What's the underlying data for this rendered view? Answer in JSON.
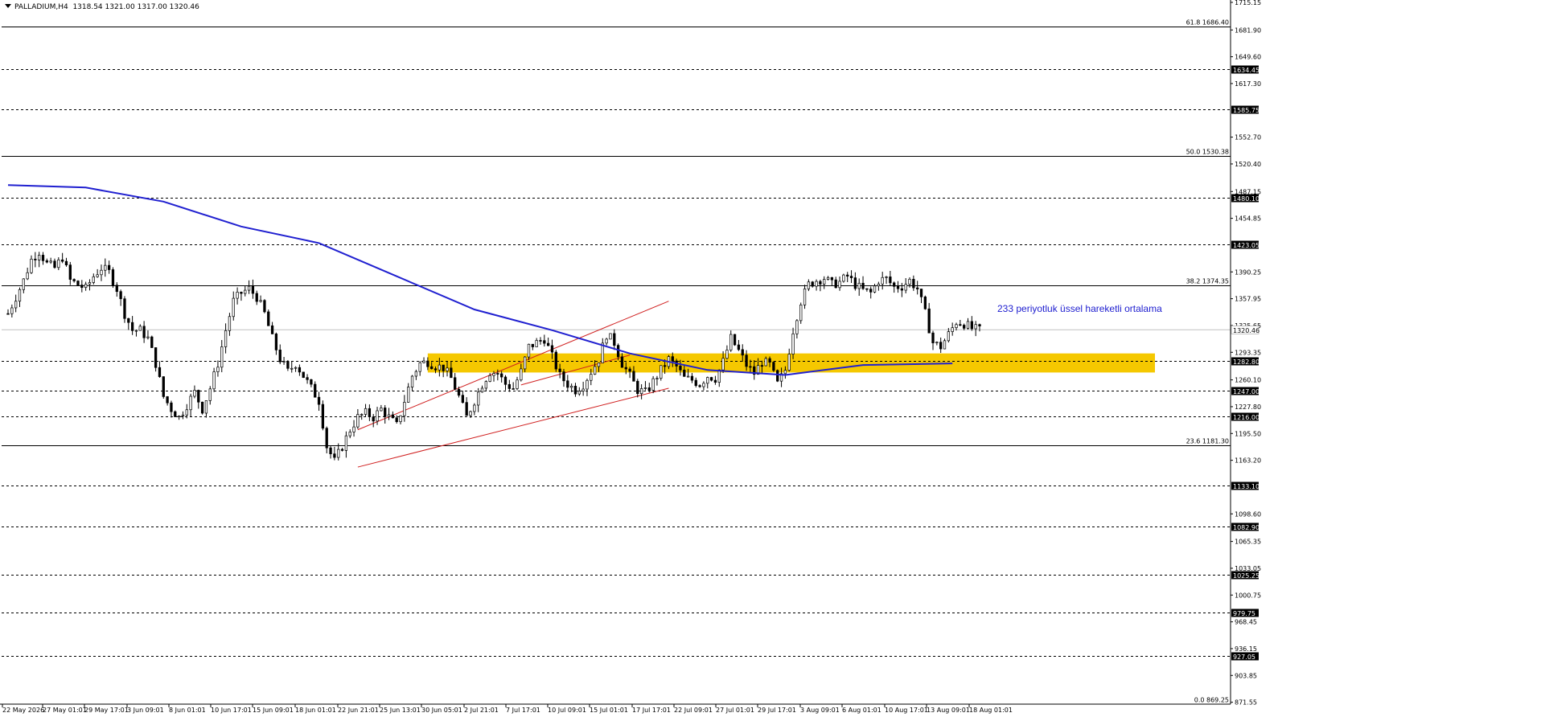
{
  "header": {
    "symbol": "PALLADIUM,H4",
    "ohlc": "1318.54 1321.00 1317.00 1320.46"
  },
  "annotation": {
    "ema_label": "233 periyotluk üssel hareketli ortalama"
  },
  "colors": {
    "background": "#ffffff",
    "ema": "#2020d0",
    "zone": "#f5c800",
    "channel": "#d02020",
    "level_line": "#000000",
    "candle": "#000000",
    "price_line": "#c0c0c0"
  },
  "chart_data": {
    "type": "candlestick",
    "title": "PALLADIUM,H4",
    "ylim": [
      869.25,
      1718
    ],
    "y_ticks": [
      {
        "v": 1715.15,
        "label": "1715.15"
      },
      {
        "v": 1681.9,
        "label": "1681.90"
      },
      {
        "v": 1649.6,
        "label": "1649.60"
      },
      {
        "v": 1617.3,
        "label": "1617.30"
      },
      {
        "v": 1552.7,
        "label": "1552.70"
      },
      {
        "v": 1520.4,
        "label": "1520.40"
      },
      {
        "v": 1487.15,
        "label": "1487.15"
      },
      {
        "v": 1454.85,
        "label": "1454.85"
      },
      {
        "v": 1390.25,
        "label": "1390.25"
      },
      {
        "v": 1357.95,
        "label": "1357.95"
      },
      {
        "v": 1325.65,
        "label": "1325.65"
      },
      {
        "v": 1293.35,
        "label": "1293.35"
      },
      {
        "v": 1260.1,
        "label": "1260.10"
      },
      {
        "v": 1227.8,
        "label": "1227.80"
      },
      {
        "v": 1195.5,
        "label": "1195.50"
      },
      {
        "v": 1163.2,
        "label": "1163.20"
      },
      {
        "v": 1098.6,
        "label": "1098.60"
      },
      {
        "v": 1065.35,
        "label": "1065.35"
      },
      {
        "v": 1033.05,
        "label": "1033.05"
      },
      {
        "v": 1000.75,
        "label": "1000.75"
      },
      {
        "v": 968.45,
        "label": "968.45"
      },
      {
        "v": 936.15,
        "label": "936.15"
      },
      {
        "v": 903.85,
        "label": "903.85"
      },
      {
        "v": 871.55,
        "label": "871.55"
      }
    ],
    "x_ticks": [
      "22 May 2026",
      "27 May 01:01",
      "29 May 17:01",
      "3 Jun 09:01",
      "8 Jun 01:01",
      "10 Jun 17:01",
      "15 Jun 09:01",
      "18 Jun 01:01",
      "22 Jun 21:01",
      "25 Jun 13:01",
      "30 Jun 05:01",
      "2 Jul 21:01",
      "7 Jul 17:01",
      "10 Jul 09:01",
      "15 Jul 01:01",
      "17 Jul 17:01",
      "22 Jul 09:01",
      "27 Jul 01:01",
      "29 Jul 17:01",
      "3 Aug 09:01",
      "6 Aug 01:01",
      "10 Aug 17:01",
      "13 Aug 09:01",
      "18 Aug 01:01"
    ],
    "horizontal_levels": [
      1634.45,
      1585.75,
      1480.1,
      1423.05,
      1282.8,
      1247.0,
      1216.0,
      1133.1,
      1082.9,
      1025.25,
      979.75,
      927.05
    ],
    "fibonacci_levels": [
      {
        "ratio": "61.8",
        "value": 1686.4,
        "label": "61.8 1686.40"
      },
      {
        "ratio": "50.0",
        "value": 1530.38,
        "label": "50.0 1530.38"
      },
      {
        "ratio": "38.2",
        "value": 1374.35,
        "label": "38.2 1374.35"
      },
      {
        "ratio": "23.6",
        "value": 1181.3,
        "label": "23.6 1181.30"
      },
      {
        "ratio": "0.0",
        "value": 869.25,
        "label": "0.0 869.25"
      }
    ],
    "current_price": 1320.46,
    "zone": {
      "from": 1269,
      "to": 1292
    },
    "price_path": [
      [
        0,
        1340
      ],
      [
        4,
        1360
      ],
      [
        8,
        1380
      ],
      [
        12,
        1405
      ],
      [
        16,
        1415
      ],
      [
        20,
        1400
      ],
      [
        24,
        1395
      ],
      [
        28,
        1408
      ],
      [
        32,
        1380
      ],
      [
        36,
        1375
      ],
      [
        40,
        1370
      ],
      [
        44,
        1385
      ],
      [
        48,
        1395
      ],
      [
        52,
        1390
      ],
      [
        56,
        1370
      ],
      [
        60,
        1340
      ],
      [
        64,
        1320
      ],
      [
        68,
        1320
      ],
      [
        72,
        1310
      ],
      [
        76,
        1280
      ],
      [
        80,
        1240
      ],
      [
        84,
        1225
      ],
      [
        88,
        1215
      ],
      [
        92,
        1230
      ],
      [
        96,
        1245
      ],
      [
        100,
        1225
      ],
      [
        104,
        1250
      ],
      [
        108,
        1280
      ],
      [
        112,
        1320
      ],
      [
        116,
        1355
      ],
      [
        120,
        1365
      ],
      [
        124,
        1370
      ],
      [
        128,
        1360
      ],
      [
        132,
        1340
      ],
      [
        136,
        1310
      ],
      [
        140,
        1285
      ],
      [
        144,
        1270
      ],
      [
        148,
        1280
      ],
      [
        152,
        1265
      ],
      [
        156,
        1250
      ],
      [
        160,
        1235
      ],
      [
        164,
        1180
      ],
      [
        168,
        1162
      ],
      [
        172,
        1180
      ],
      [
        176,
        1200
      ],
      [
        180,
        1215
      ],
      [
        184,
        1220
      ],
      [
        188,
        1215
      ],
      [
        192,
        1225
      ],
      [
        196,
        1215
      ],
      [
        200,
        1205
      ],
      [
        204,
        1235
      ],
      [
        208,
        1265
      ],
      [
        212,
        1280
      ],
      [
        216,
        1282
      ],
      [
        220,
        1277
      ],
      [
        224,
        1275
      ],
      [
        228,
        1262
      ],
      [
        232,
        1240
      ],
      [
        236,
        1215
      ],
      [
        240,
        1235
      ],
      [
        244,
        1255
      ],
      [
        248,
        1270
      ],
      [
        252,
        1268
      ],
      [
        256,
        1255
      ],
      [
        260,
        1250
      ],
      [
        264,
        1270
      ],
      [
        268,
        1300
      ],
      [
        272,
        1305
      ],
      [
        276,
        1310
      ],
      [
        280,
        1288
      ],
      [
        284,
        1265
      ],
      [
        288,
        1255
      ],
      [
        292,
        1248
      ],
      [
        296,
        1255
      ],
      [
        300,
        1270
      ],
      [
        304,
        1285
      ],
      [
        308,
        1315
      ],
      [
        312,
        1305
      ],
      [
        316,
        1280
      ],
      [
        320,
        1265
      ],
      [
        324,
        1248
      ],
      [
        328,
        1245
      ],
      [
        332,
        1258
      ],
      [
        336,
        1272
      ],
      [
        340,
        1285
      ],
      [
        344,
        1276
      ],
      [
        348,
        1262
      ],
      [
        352,
        1260
      ],
      [
        356,
        1255
      ],
      [
        360,
        1265
      ],
      [
        364,
        1262
      ],
      [
        368,
        1282
      ],
      [
        372,
        1310
      ],
      [
        376,
        1295
      ],
      [
        380,
        1278
      ],
      [
        384,
        1268
      ],
      [
        388,
        1282
      ],
      [
        392,
        1278
      ],
      [
        396,
        1255
      ],
      [
        400,
        1272
      ],
      [
        404,
        1320
      ],
      [
        408,
        1355
      ],
      [
        412,
        1375
      ],
      [
        416,
        1380
      ],
      [
        420,
        1383
      ],
      [
        424,
        1375
      ],
      [
        428,
        1378
      ],
      [
        432,
        1385
      ],
      [
        436,
        1375
      ],
      [
        440,
        1368
      ],
      [
        444,
        1365
      ],
      [
        448,
        1380
      ],
      [
        452,
        1382
      ],
      [
        456,
        1372
      ],
      [
        460,
        1373
      ],
      [
        464,
        1380
      ],
      [
        468,
        1370
      ],
      [
        472,
        1340
      ],
      [
        476,
        1305
      ],
      [
        480,
        1300
      ],
      [
        484,
        1315
      ],
      [
        488,
        1330
      ],
      [
        492,
        1328
      ],
      [
        496,
        1322
      ],
      [
        500,
        1320
      ]
    ],
    "ema_path": [
      [
        0,
        1495
      ],
      [
        40,
        1492
      ],
      [
        80,
        1475
      ],
      [
        120,
        1445
      ],
      [
        160,
        1425
      ],
      [
        200,
        1385
      ],
      [
        240,
        1345
      ],
      [
        280,
        1320
      ],
      [
        320,
        1292
      ],
      [
        360,
        1272
      ],
      [
        400,
        1266
      ],
      [
        440,
        1278
      ],
      [
        486,
        1280
      ]
    ],
    "channel_lines": [
      [
        [
          180,
          1200
        ],
        [
          340,
          1355
        ]
      ],
      [
        [
          180,
          1155
        ],
        [
          340,
          1250
        ]
      ],
      [
        [
          264,
          1254
        ],
        [
          320,
          1290
        ]
      ]
    ]
  }
}
